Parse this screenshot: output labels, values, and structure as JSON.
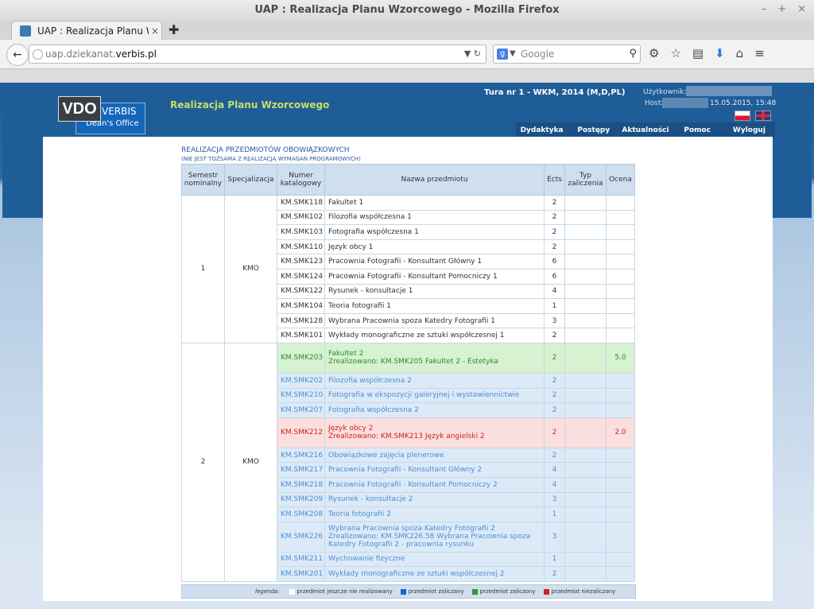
{
  "window": {
    "title": "UAP : Realizacja Planu Wzorcowego - Mozilla Firefox"
  },
  "tab": {
    "title": "UAP : Realizacja Planu Wz..."
  },
  "urlbar": {
    "prefix": "uap.dziekanat.",
    "host": "verbis.pl"
  },
  "search": {
    "placeholder": "Google"
  },
  "app": {
    "logo_vdo": "VDO",
    "logo_verbis": "VERBIS",
    "logo_sub": "Dean's Office",
    "title": "Realizacja Planu Wzorcowego",
    "tura": "Tura nr 1 - WKM, 2014 (M,D,PL)",
    "user_label": "Użytkownik:",
    "host_label": "Host:",
    "datetime": "15.05.2015, 15:48",
    "menu": [
      "Dydaktyka",
      "Postępy",
      "Aktualności",
      "Pomoc",
      "Wyloguj"
    ]
  },
  "section": {
    "title": "REALIZACJA PRZEDMIOTÓW OBOWIĄZKOWYCH",
    "subtitle": "(NIE JEST TOŻSAMA Z REALIZACJĄ WYMAGAŃ PROGRAMOWYCH)"
  },
  "table": {
    "headers": [
      "Semestr nominalny",
      "Specjalizacja",
      "Numer katalogowy",
      "Nazwa przedmiotu",
      "Ects",
      "Typ zaliczenia",
      "Ocena"
    ],
    "groups": [
      {
        "semestr": "1",
        "spec": "KMO",
        "rows": [
          {
            "code": "KM.SMK118",
            "name": "Fakultet 1",
            "ects": "2",
            "typ": "",
            "ocena": "",
            "status": "none"
          },
          {
            "code": "KM.SMK102",
            "name": "Filozofia współczesna 1",
            "ects": "2",
            "typ": "",
            "ocena": "",
            "status": "none"
          },
          {
            "code": "KM.SMK103",
            "name": "Fotografia współczesna 1",
            "ects": "2",
            "typ": "",
            "ocena": "",
            "status": "none"
          },
          {
            "code": "KM.SMK110",
            "name": "Język obcy 1",
            "ects": "2",
            "typ": "",
            "ocena": "",
            "status": "none"
          },
          {
            "code": "KM.SMK123",
            "name": "Pracownia Fotografii - Konsultant Główny 1",
            "ects": "6",
            "typ": "",
            "ocena": "",
            "status": "none"
          },
          {
            "code": "KM.SMK124",
            "name": "Pracownia Fotografii - Konsultant Pomocniczy 1",
            "ects": "6",
            "typ": "",
            "ocena": "",
            "status": "none"
          },
          {
            "code": "KM.SMK122",
            "name": "Rysunek - konsultacje 1",
            "ects": "4",
            "typ": "",
            "ocena": "",
            "status": "none"
          },
          {
            "code": "KM.SMK104",
            "name": "Teoria fotografii 1",
            "ects": "1",
            "typ": "",
            "ocena": "",
            "status": "none"
          },
          {
            "code": "KM.SMK128",
            "name": "Wybrana Pracownia spoza Katedry Fotografii 1",
            "ects": "3",
            "typ": "",
            "ocena": "",
            "status": "none"
          },
          {
            "code": "KM.SMK101",
            "name": "Wykłady monograficzne ze sztuki współczesnej 1",
            "ects": "2",
            "typ": "",
            "ocena": "",
            "status": "none"
          }
        ]
      },
      {
        "semestr": "2",
        "spec": "KMO",
        "rows": [
          {
            "code": "KM.SMK203",
            "name": "Fakultet 2",
            "name2": "Zrealizowano: KM.SMK205 Fakultet 2 - Estetyka",
            "ects": "2",
            "typ": "",
            "ocena": "5.0",
            "status": "done"
          },
          {
            "code": "KM.SMK202",
            "name": "Filozofia współczesna 2",
            "ects": "2",
            "typ": "",
            "ocena": "",
            "status": "pass"
          },
          {
            "code": "KM.SMK210",
            "name": "Fotografia w ekspozycji galeryjnej i wystawiennictwie",
            "ects": "2",
            "typ": "",
            "ocena": "",
            "status": "pass"
          },
          {
            "code": "KM.SMK207",
            "name": "Fotografia współczesna 2",
            "ects": "2",
            "typ": "",
            "ocena": "",
            "status": "pass"
          },
          {
            "code": "KM.SMK212",
            "name": "Język obcy 2",
            "name2": "Zrealizowano: KM.SMK213 Język angielski 2",
            "ects": "2",
            "typ": "",
            "ocena": "2.0",
            "status": "fail"
          },
          {
            "code": "KM.SMK216",
            "name": "Obowiązkowe zajęcia plenerowe",
            "ects": "2",
            "typ": "",
            "ocena": "",
            "status": "pass"
          },
          {
            "code": "KM.SMK217",
            "name": "Pracownia Fotografii - Konsultant Główny 2",
            "ects": "4",
            "typ": "",
            "ocena": "",
            "status": "pass"
          },
          {
            "code": "KM.SMK218",
            "name": "Pracownia Fotografii - Konsultant Pomocniczy 2",
            "ects": "4",
            "typ": "",
            "ocena": "",
            "status": "pass"
          },
          {
            "code": "KM.SMK209",
            "name": "Rysunek - konsultacje 2",
            "ects": "3",
            "typ": "",
            "ocena": "",
            "status": "pass"
          },
          {
            "code": "KM.SMK208",
            "name": "Teoria fotografii 2",
            "ects": "1",
            "typ": "",
            "ocena": "",
            "status": "pass"
          },
          {
            "code": "KM.SMK226",
            "name": "Wybrana Pracownia spoza Katedry Fotografii 2",
            "name2": "Zrealizowano: KM.SMK226.58 Wybrana Pracownia spoza Katedry Fotografii 2 - pracownia rysunku",
            "ects": "3",
            "typ": "",
            "ocena": "",
            "status": "pass"
          },
          {
            "code": "KM.SMK211",
            "name": "Wychowanie fizyczne",
            "ects": "1",
            "typ": "",
            "ocena": "",
            "status": "pass"
          },
          {
            "code": "KM.SMK201",
            "name": "Wykłady monograficzne ze sztuki współczesnej 2",
            "ects": "2",
            "typ": "",
            "ocena": "",
            "status": "pass"
          }
        ]
      }
    ]
  },
  "legend": {
    "label": "legenda:",
    "items": [
      {
        "text": "przedmiot jeszcze nie realizowany",
        "color": "#ffffff"
      },
      {
        "text": "przedmiot zaliczany",
        "color": "#1565d8"
      },
      {
        "text": "przedmiot zaliczony",
        "color": "#2e9b2e"
      },
      {
        "text": "przedmiot niezaliczony",
        "color": "#d42020"
      }
    ]
  }
}
